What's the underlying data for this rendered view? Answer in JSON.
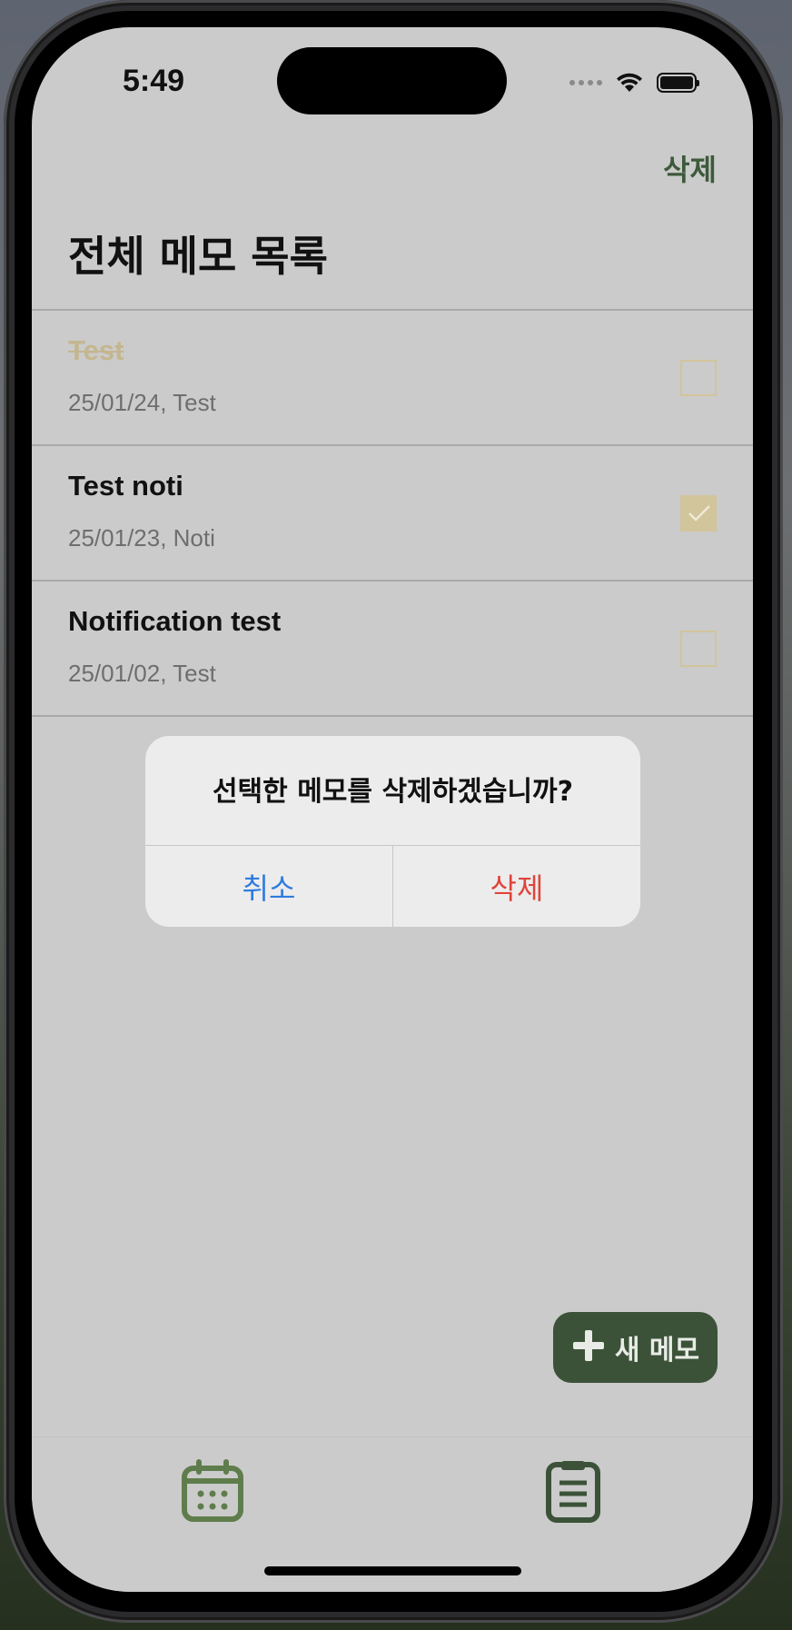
{
  "status_bar": {
    "time": "5:49"
  },
  "header": {
    "delete_label": "삭제",
    "title": "전체 메모 목록"
  },
  "memos": [
    {
      "title": "Test",
      "subtitle": "25/01/24, Test",
      "done": true,
      "checked": false
    },
    {
      "title": "Test noti",
      "subtitle": "25/01/23, Noti",
      "done": false,
      "checked": true
    },
    {
      "title": "Notification test",
      "subtitle": "25/01/02, Test",
      "done": false,
      "checked": false
    }
  ],
  "alert": {
    "message": "선택한 메모를 삭제하겠습니까?",
    "cancel_label": "취소",
    "confirm_label": "삭제"
  },
  "fab": {
    "icon": "plus-icon",
    "label": "새 메모"
  },
  "tabbar": {
    "items": [
      {
        "icon": "calendar-icon"
      },
      {
        "icon": "clipboard-list-icon"
      }
    ]
  },
  "colors": {
    "accent": "#3d5a3b",
    "checkbox": "#d2c49b",
    "cancel": "#2e7be0",
    "destructive": "#e0443a"
  }
}
